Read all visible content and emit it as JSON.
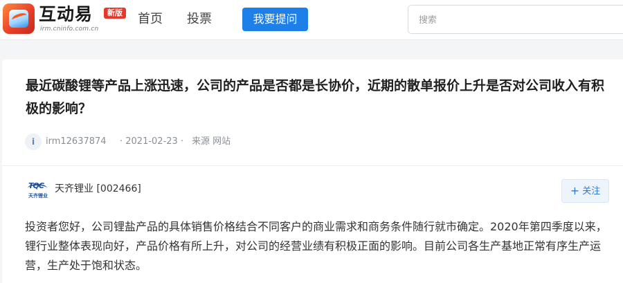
{
  "header": {
    "logo": {
      "title": "互动易",
      "badge": "新版",
      "domain": "irm.cninfo.com.cn"
    },
    "nav": [
      {
        "label": "首页"
      },
      {
        "label": "投票"
      }
    ],
    "ask_button": "我要提问",
    "search": {
      "placeholder": "搜索",
      "value": ""
    }
  },
  "question": {
    "title": "最近碳酸锂等产品上涨迅速，公司的产品是否都是长协价，近期的散单报价上升是否对公司收入有积极的影响？",
    "avatar_letter": "i",
    "user": "irm12637874",
    "date": "· 2021-02-23 ·",
    "source": "来源 网站"
  },
  "answer": {
    "company_logo_text": "TQC",
    "company_logo_cn": "天齐锂业",
    "company": "天齐锂业 [002466]",
    "follow_label": "关注",
    "text": "投资者您好，公司锂盐产品的具体销售价格结合不同客户的商业需求和商务条件随行就市确定。2020年第四季度以来，锂行业整体表现向好，产品价格有所上升，对公司的经营业绩有积极正面的影响。目前公司各生产基地正常有序生产运营，生产处于饱和状态。"
  },
  "colors": {
    "accent": "#1d7fe8",
    "badge": "#e6382a",
    "background": "#f3f5f7"
  }
}
